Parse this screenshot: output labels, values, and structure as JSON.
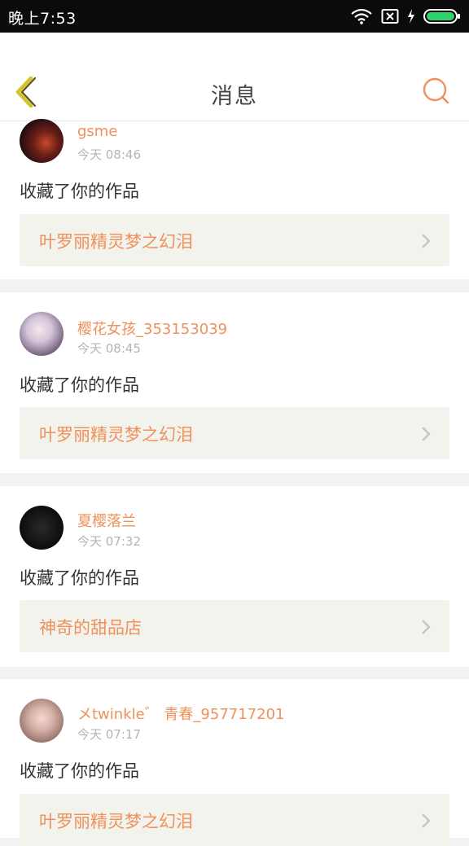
{
  "status_bar": {
    "time": "晚上7:53"
  },
  "header": {
    "title": "消息"
  },
  "messages": [
    {
      "username": "gsme",
      "time": "今天 08:46",
      "action": "收藏了你的作品",
      "work_title": "叶罗丽精灵梦之幻泪"
    },
    {
      "username": "樱花女孩_353153039",
      "time": "今天 08:45",
      "action": "收藏了你的作品",
      "work_title": "叶罗丽精灵梦之幻泪"
    },
    {
      "username": "夏樱落兰",
      "time": "今天 07:32",
      "action": "收藏了你的作品",
      "work_title": "神奇的甜品店"
    },
    {
      "username": "メtwinkle゛ 青春_957717201",
      "time": "今天 07:17",
      "action": "收藏了你的作品",
      "work_title": "叶罗丽精灵梦之幻泪"
    }
  ],
  "colors": {
    "accent": "#f0905a",
    "back_icon": "#d4c22b",
    "work_bg": "#f3f3ee",
    "divider": "#f2f2f2"
  },
  "icons": [
    "wifi-icon",
    "sim-off-icon",
    "charging-icon",
    "battery-icon",
    "back-icon",
    "search-icon",
    "chevron-right-icon"
  ]
}
